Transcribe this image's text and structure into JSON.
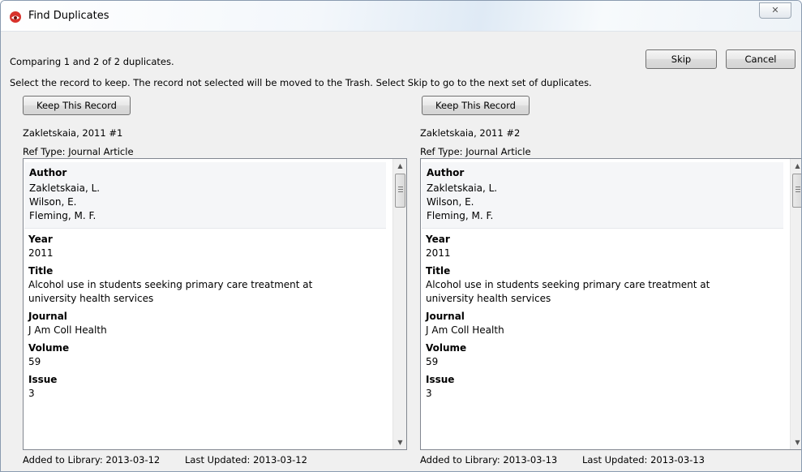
{
  "window": {
    "title": "Find Duplicates",
    "close_label": "✕"
  },
  "header": {
    "comparing_text": "Comparing 1 and 2 of 2 duplicates.",
    "instructions": "Select the record to keep. The record not selected will be moved to the Trash. Select Skip to go to the next set of duplicates.",
    "skip_label": "Skip",
    "cancel_label": "Cancel"
  },
  "records": [
    {
      "keep_label": "Keep This Record",
      "name": "Zakletskaia, 2011 #1",
      "ref_type": "Ref Type: Journal Article",
      "author_label": "Author",
      "authors": [
        "Zakletskaia, L.",
        "Wilson, E.",
        "Fleming, M. F."
      ],
      "year_label": "Year",
      "year": "2011",
      "title_label": "Title",
      "title_line1": "Alcohol use in students seeking primary care treatment at",
      "title_line2": "university health services",
      "journal_label": "Journal",
      "journal": "J Am Coll Health",
      "volume_label": "Volume",
      "volume": "59",
      "issue_label": "Issue",
      "issue": "3",
      "added": "Added to Library: 2013-03-12",
      "updated": "Last Updated: 2013-03-12"
    },
    {
      "keep_label": "Keep This Record",
      "name": "Zakletskaia, 2011 #2",
      "ref_type": "Ref Type: Journal Article",
      "author_label": "Author",
      "authors": [
        "Zakletskaia, L.",
        "Wilson, E.",
        "Fleming, M. F."
      ],
      "year_label": "Year",
      "year": "2011",
      "title_label": "Title",
      "title_line1": "Alcohol use in students seeking primary care treatment at",
      "title_line2": "university health services",
      "journal_label": "Journal",
      "journal": "J Am Coll Health",
      "volume_label": "Volume",
      "volume": "59",
      "issue_label": "Issue",
      "issue": "3",
      "added": "Added to Library: 2013-03-13",
      "updated": "Last Updated: 2013-03-13"
    }
  ],
  "icons": {
    "app": "endnote-app-icon",
    "scroll_up": "chevron-up-icon",
    "scroll_down": "chevron-down-icon"
  },
  "colors": {
    "app_icon_red": "#d8322c",
    "panel_border": "#828790"
  }
}
